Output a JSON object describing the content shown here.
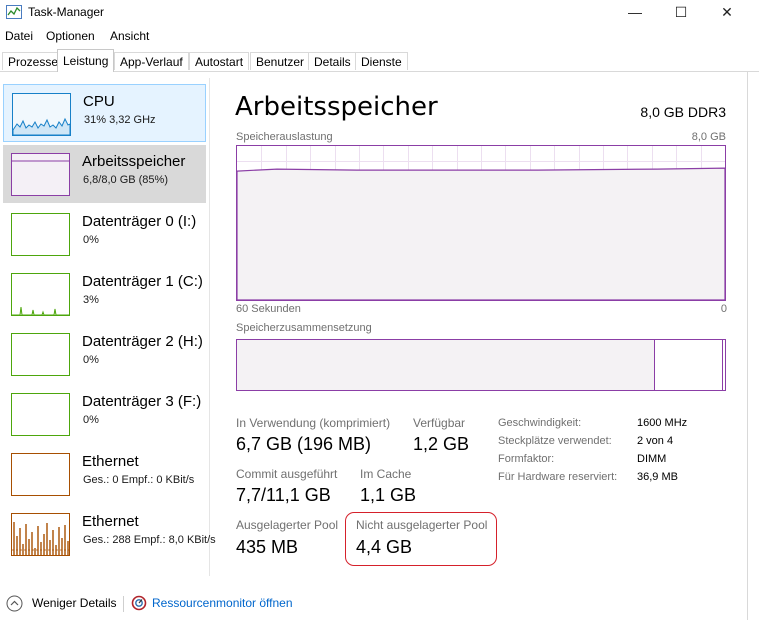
{
  "window": {
    "title": "Task-Manager",
    "minimize": "—",
    "maximize": "☐",
    "close": "✕"
  },
  "menu": [
    "Datei",
    "Optionen",
    "Ansicht"
  ],
  "tabs": [
    "Prozesse",
    "Leistung",
    "App-Verlauf",
    "Autostart",
    "Benutzer",
    "Details",
    "Dienste"
  ],
  "active_tab": "Leistung",
  "sidebar": [
    {
      "name": "CPU",
      "sub": "31% 3,32 GHz",
      "color": "#1780c8"
    },
    {
      "name": "Arbeitsspeicher",
      "sub": "6,8/8,0 GB (85%)",
      "color": "#8b3ea6"
    },
    {
      "name": "Datenträger 0 (I:)",
      "sub": "0%",
      "color": "#4da60c"
    },
    {
      "name": "Datenträger 1 (C:)",
      "sub": "3%",
      "color": "#4da60c"
    },
    {
      "name": "Datenträger 2 (H:)",
      "sub": "0%",
      "color": "#4da60c"
    },
    {
      "name": "Datenträger 3 (F:)",
      "sub": "0%",
      "color": "#4da60c"
    },
    {
      "name": "Ethernet",
      "sub": "Ges.: 0 Empf.: 0 KBit/s",
      "color": "#a74f01"
    },
    {
      "name": "Ethernet",
      "sub": "Ges.: 288 Empf.: 8,0 KBit/s",
      "color": "#a74f01"
    }
  ],
  "main": {
    "title": "Arbeitsspeicher",
    "spec": "8,0 GB DDR3",
    "usage_label": "Speicherauslastung",
    "usage_max": "8,0 GB",
    "time_left": "60 Sekunden",
    "time_right": "0",
    "composition_label": "Speicherzusammensetzung",
    "usage_fraction": 0.85,
    "stats": {
      "in_use_label": "In Verwendung (komprimiert)",
      "in_use_value": "6,7 GB (196 MB)",
      "available_label": "Verfügbar",
      "available_value": "1,2 GB",
      "commit_label": "Commit ausgeführt",
      "commit_value": "7,7/11,1 GB",
      "cache_label": "Im Cache",
      "cache_value": "1,1 GB",
      "paged_label": "Ausgelagerter Pool",
      "paged_value": "435 MB",
      "nonpaged_label": "Nicht ausgelagerter Pool",
      "nonpaged_value": "4,4 GB"
    },
    "specs": [
      {
        "label": "Geschwindigkeit:",
        "value": "1600 MHz"
      },
      {
        "label": "Steckplätze verwendet:",
        "value": "2 von 4"
      },
      {
        "label": "Formfaktor:",
        "value": "DIMM"
      },
      {
        "label": "Für Hardware reserviert:",
        "value": "36,9 MB"
      }
    ]
  },
  "footer": {
    "fewer": "Weniger Details",
    "resmon": "Ressourcenmonitor öffnen"
  },
  "colors": {
    "memory": "#8b3ea6",
    "cpu": "#1780c8",
    "disk": "#4da60c",
    "ethernet": "#a74f01",
    "highlight": "#d5212b",
    "link": "#0066cc"
  }
}
